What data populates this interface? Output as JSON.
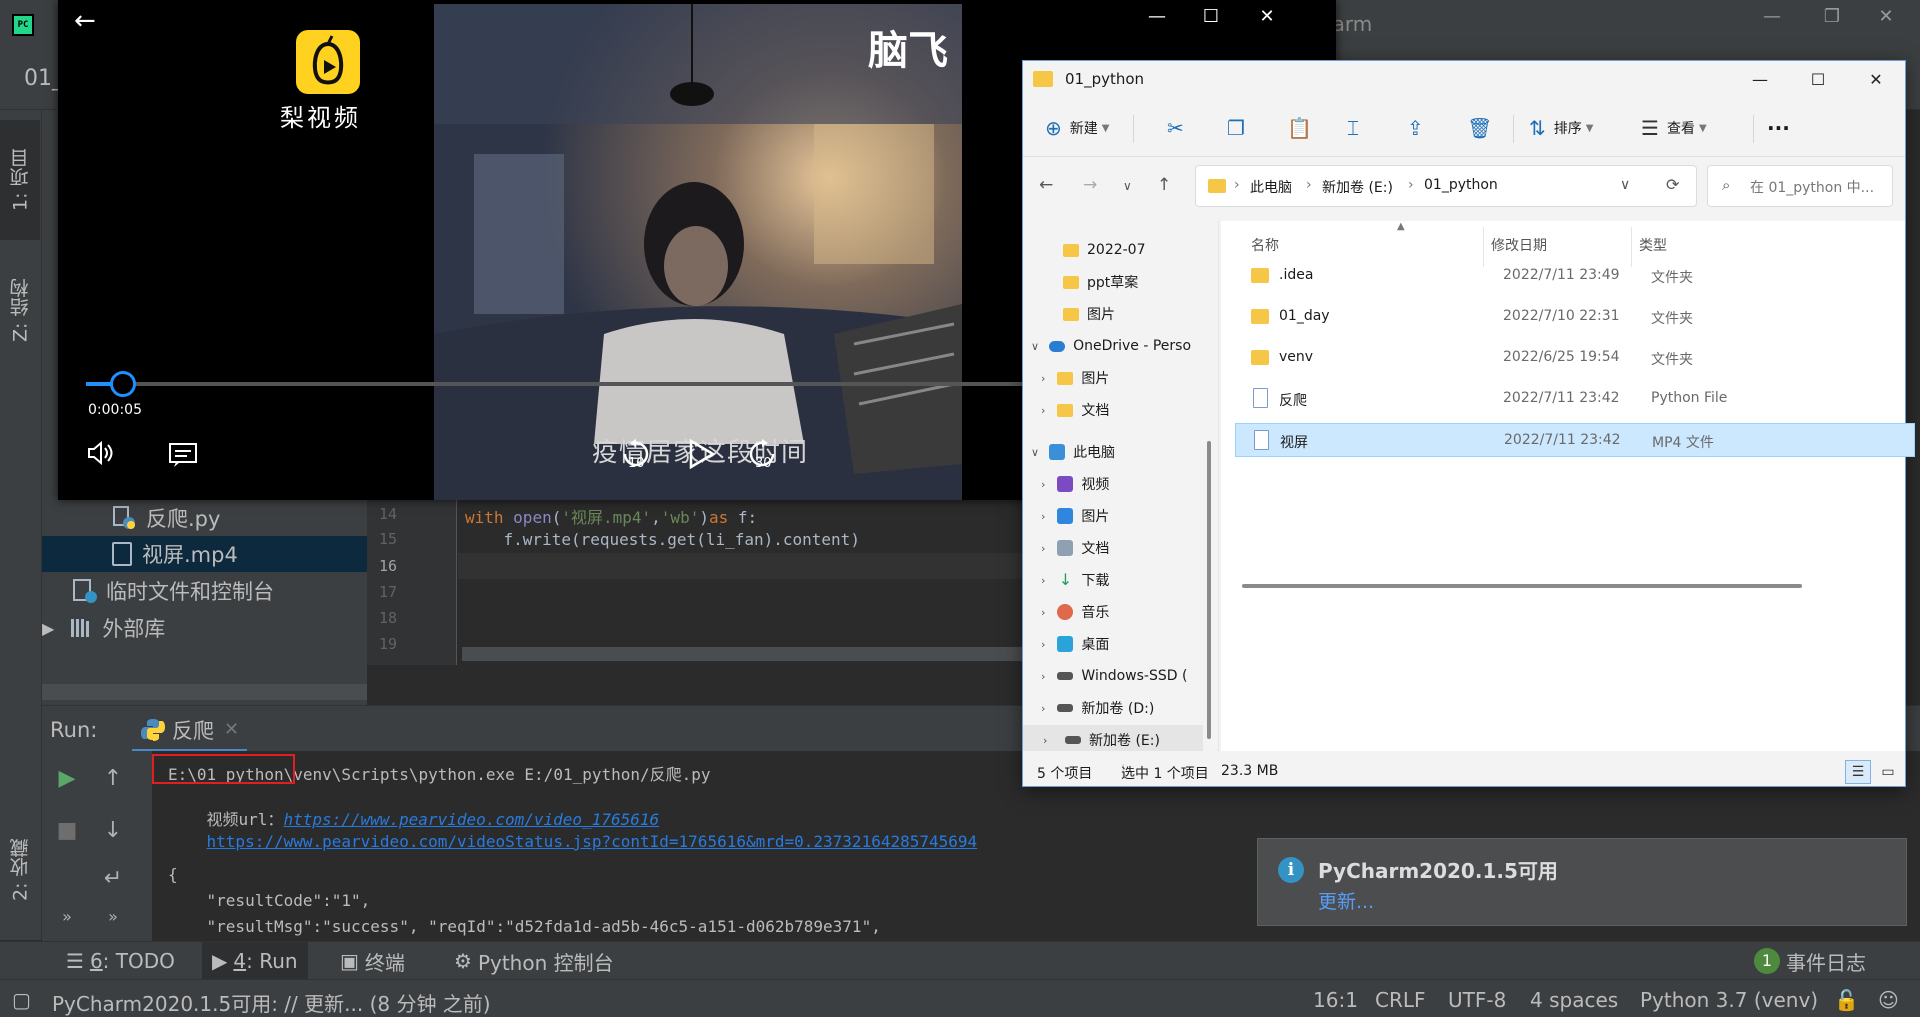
{
  "pycharm": {
    "logo_text": "PC",
    "title_fragment": "harm",
    "nav_fragment": "01_",
    "window_controls": {
      "minimize": "—",
      "restore": "❐",
      "close": "✕"
    },
    "left_tabs": [
      "1: 项目",
      "Z: 结构",
      "2: 收藏"
    ],
    "project_tree": [
      {
        "label": "反爬.py",
        "icon": "python-file-icon",
        "selected": false
      },
      {
        "label": "视屏.mp4",
        "icon": "file-icon",
        "selected": true
      },
      {
        "label": "临时文件和控制台",
        "icon": "scratches-icon",
        "selected": false
      },
      {
        "label": "外部库",
        "icon": "library-icon",
        "selected": false
      }
    ],
    "editor": {
      "line_numbers": [
        "14",
        "15",
        "16",
        "17",
        "18",
        "19"
      ],
      "current_line": "16",
      "line14": {
        "kw": "with",
        "fn": "open",
        "p1": "(",
        "s1": "'视屏.mp4'",
        "p2": ",",
        "s2": "'wb'",
        "p3": ")",
        "kw2": "as",
        "rest": " f:"
      },
      "line15": "    f.write(requests.get(li_fan).content)"
    },
    "run": {
      "label": "Run:",
      "tab_label": "反爬",
      "tab_close": "✕",
      "console_lines": {
        "cmd": "E:\\01_python\\venv\\Scripts\\python.exe E:/01_python/反爬.py",
        "video_url_label": "视频url：",
        "video_url": "https://www.pearvideo.com/video_1765616",
        "status_url": "https://www.pearvideo.com/videoStatus.jsp?contId=1765616&mrd=0.23732164285745694",
        "brace": "{",
        "result_code": "    \"resultCode\":\"1\",",
        "result_msg": "    \"resultMsg\":\"success\", \"reqId\":\"d52fda1d-ad5b-46c5-a151-d062b789e371\","
      }
    },
    "bottom_tabs": [
      {
        "num": "6",
        "label": ": TODO"
      },
      {
        "num": "4",
        "label": ": Run"
      },
      {
        "num": "",
        "label": "终端"
      },
      {
        "num": "",
        "label": "Python 控制台"
      }
    ],
    "event_log": {
      "count": "1",
      "label": "事件日志"
    },
    "status": {
      "message": "PyCharm2020.1.5可用: // 更新... (8 分钟 之前)",
      "position": "16:1",
      "line_sep": "CRLF",
      "encoding": "UTF-8",
      "indent": "4 spaces",
      "interpreter": "Python 3.7 (venv)"
    },
    "notification": {
      "icon": "i",
      "title": "PyCharm2020.1.5可用",
      "link": "更新..."
    }
  },
  "player": {
    "brand_name": "梨视频",
    "corner_logo": "脑飞",
    "time": "0:00:05",
    "progress_fraction": 0.03,
    "rewind_seconds": "10",
    "forward_seconds": "30",
    "subtitle": "疫情居家这段时间",
    "controls": {
      "back": "←",
      "minimize": "—",
      "maximize": "☐",
      "close": "✕"
    }
  },
  "explorer": {
    "title": "01_python",
    "window_controls": {
      "minimize": "—",
      "maximize": "☐",
      "close": "✕"
    },
    "toolbar": {
      "new": "新建",
      "sort": "排序",
      "view": "查看",
      "more": "···"
    },
    "breadcrumb": [
      "此电脑",
      "新加卷 (E:)",
      "01_python"
    ],
    "search_placeholder": "在 01_python 中...",
    "nav_items": [
      {
        "label": "2022-07",
        "icon": "folder-icon",
        "indent": 1
      },
      {
        "label": "ppt草案",
        "icon": "folder-icon",
        "indent": 1
      },
      {
        "label": "图片",
        "icon": "folder-icon",
        "indent": 1
      },
      {
        "label": "OneDrive - Perso",
        "icon": "onedrive-icon",
        "indent": 0,
        "expanded": true
      },
      {
        "label": "图片",
        "icon": "folder-icon",
        "indent": 1,
        "chevron": true
      },
      {
        "label": "文档",
        "icon": "folder-icon",
        "indent": 1,
        "chevron": true
      },
      {
        "label": "此电脑",
        "icon": "pc-icon",
        "indent": 0,
        "expanded": true
      },
      {
        "label": "视频",
        "icon": "video-icon",
        "indent": 1,
        "chevron": true
      },
      {
        "label": "图片",
        "icon": "pictures-icon",
        "indent": 1,
        "chevron": true
      },
      {
        "label": "文档",
        "icon": "documents-icon",
        "indent": 1,
        "chevron": true
      },
      {
        "label": "下载",
        "icon": "download-icon",
        "indent": 1,
        "chevron": true
      },
      {
        "label": "音乐",
        "icon": "music-icon",
        "indent": 1,
        "chevron": true
      },
      {
        "label": "桌面",
        "icon": "desktop-icon",
        "indent": 1,
        "chevron": true
      },
      {
        "label": "Windows-SSD (",
        "icon": "drive-icon",
        "indent": 1,
        "chevron": true
      },
      {
        "label": "新加卷 (D:)",
        "icon": "drive-icon",
        "indent": 1,
        "chevron": true
      },
      {
        "label": "新加卷 (E:)",
        "icon": "drive-icon",
        "indent": 1,
        "chevron": true,
        "selected": true
      }
    ],
    "columns": {
      "name": "名称",
      "date": "修改日期",
      "type": "类型"
    },
    "files": [
      {
        "name": ".idea",
        "date": "2022/7/11 23:49",
        "type": "文件夹",
        "kind": "folder"
      },
      {
        "name": "01_day",
        "date": "2022/7/10 22:31",
        "type": "文件夹",
        "kind": "folder"
      },
      {
        "name": "venv",
        "date": "2022/6/25 19:54",
        "type": "文件夹",
        "kind": "folder"
      },
      {
        "name": "反爬",
        "date": "2022/7/11 23:42",
        "type": "Python File",
        "kind": "python"
      },
      {
        "name": "视屏",
        "date": "2022/7/11 23:42",
        "type": "MP4 文件",
        "kind": "video",
        "selected": true
      }
    ],
    "status": {
      "count": "5 个项目",
      "selected": "选中 1 个项目",
      "size": "23.3 MB"
    }
  }
}
